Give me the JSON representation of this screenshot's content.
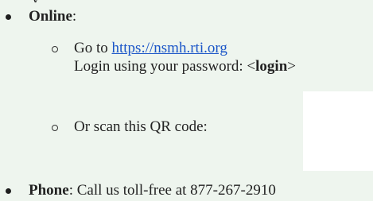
{
  "top_fragment": "y",
  "online": {
    "label": "Online",
    "suffix": ":",
    "go_to_prefix": "Go to ",
    "url": "https://nsmh.rti.org",
    "login_prefix": "Login using your password: <",
    "login_token": "login",
    "login_suffix": ">",
    "scan_text": "Or scan this QR code:"
  },
  "phone": {
    "label": "Phone",
    "rest": ": Call us toll-free at 877-267-2910"
  }
}
